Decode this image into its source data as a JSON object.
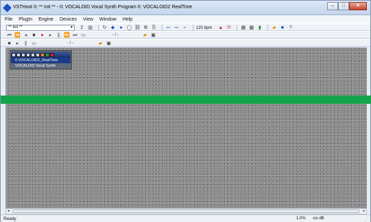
{
  "window": {
    "title": "VSTHost 0: ** Init ** - 0: VOCALOID Vocal Synth Program 0: VOCALOID2 RealTime",
    "minimize": "–",
    "maximize": "□",
    "close": "✕"
  },
  "menu": [
    "File",
    "PlugIn",
    "Engine",
    "Devices",
    "View",
    "Window",
    "Help"
  ],
  "toolbar": {
    "program_combo": "** Init **",
    "bpm": "120 bpm",
    "position1": "- / -",
    "position2": "- / -"
  },
  "plugin_window": {
    "title_strip": "0  VOCALOID2_RealTime",
    "name": "VOCALOID Vocal Synth"
  },
  "status": {
    "text": "Ready",
    "cpu": "1.0%",
    "level": "-oo dB"
  }
}
